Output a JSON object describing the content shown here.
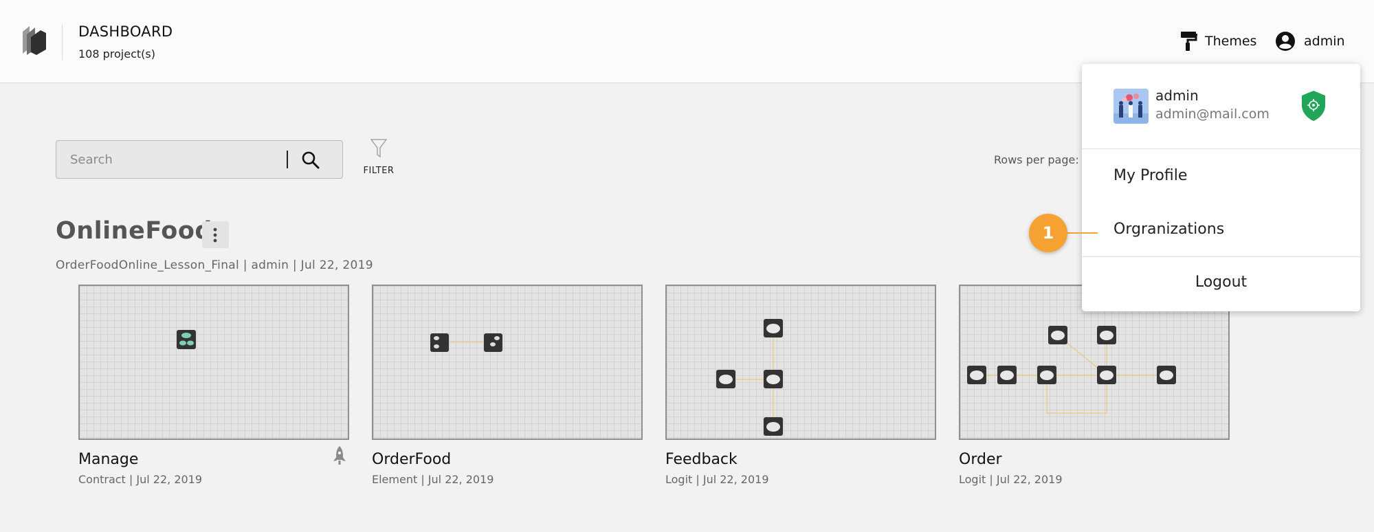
{
  "header": {
    "title": "DASHBOARD",
    "subtitle": "108 project(s)",
    "themes_label": "Themes",
    "user_label": "admin"
  },
  "toolbar": {
    "search_placeholder": "Search",
    "filter_label": "FILTER",
    "rows_per_page_label": "Rows per page:"
  },
  "group": {
    "title": "OnlineFood",
    "meta": "OrderFoodOnline_Lesson_Final | admin | Jul 22, 2019"
  },
  "cards": [
    {
      "title": "Manage",
      "meta": "Contract | Jul 22, 2019"
    },
    {
      "title": "OrderFood",
      "meta": "Element | Jul 22, 2019"
    },
    {
      "title": "Feedback",
      "meta": "Logit | Jul 22, 2019"
    },
    {
      "title": "Order",
      "meta": "Logit | Jul 22, 2019"
    }
  ],
  "dropdown": {
    "name": "admin",
    "email": "admin@mail.com",
    "items": [
      "My Profile",
      "Orgranizations"
    ],
    "logout": "Logout"
  },
  "callout": {
    "number": "1"
  },
  "icons": {
    "logo": "app-logo-icon",
    "themes": "paint-roller-icon",
    "user": "account-circle-icon",
    "search": "search-icon",
    "filter": "filter-icon",
    "group_menu": "more-vertical-icon",
    "rocket": "rocket-icon",
    "shield": "shield-icon"
  },
  "colors": {
    "accent": "#f5a233",
    "shield": "#21a559",
    "node": "#333333",
    "edge": "#f0c77a"
  }
}
